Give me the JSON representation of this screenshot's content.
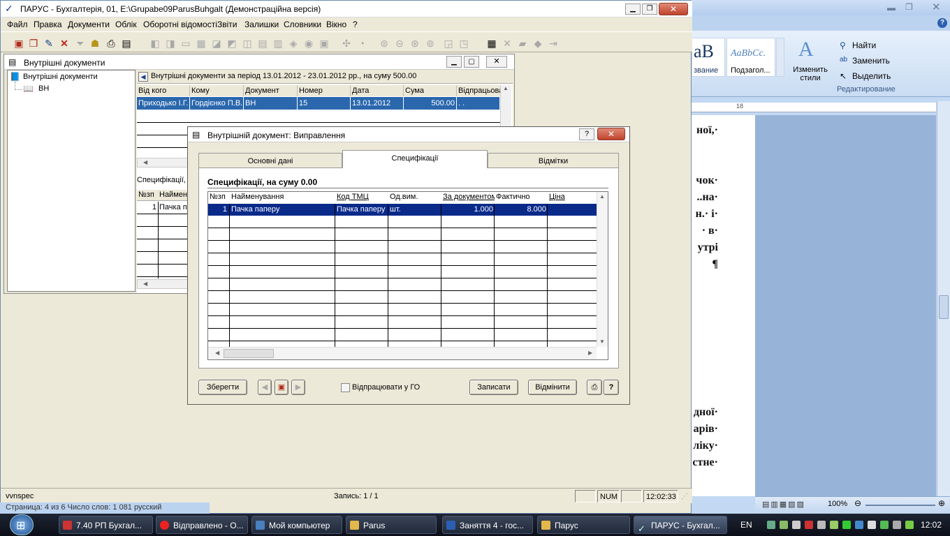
{
  "app": {
    "title": "ПАРУС - Бухгалтерія, 01, E:\\Grupabe09ParusBuhgalt (Демонстраційна версія)",
    "menu": [
      "Файл",
      "Правка",
      "Документи",
      "Облік",
      "Оборотні відомості",
      "Звіти",
      "Залишки",
      "Словники",
      "Вікно",
      "?"
    ]
  },
  "child": {
    "title": "Внутрішні документи",
    "tree": {
      "root": "Внутрішні документи",
      "child": "ВН"
    },
    "period_header": "Внутрішні документи за період 13.01.2012 - 23.01.2012 рр., на суму 500.00",
    "columns": [
      "Від кого",
      "Кому",
      "Документ",
      "Номер",
      "Дата",
      "Сума",
      "Відпрацьован"
    ],
    "rows": [
      {
        "from": "Приходько І.Г.",
        "to": "Гордієнко П.В.",
        "doc": "ВН",
        "num": "15",
        "date": "13.01.2012",
        "sum": "500.00",
        "processed": ". ."
      }
    ],
    "spec_label": "Специфікації, н",
    "spec_columns": [
      "№зп",
      "Найменув"
    ],
    "spec_rows": [
      {
        "num": "1",
        "name": "Пачка п"
      }
    ]
  },
  "dialog": {
    "title": "Внутрішній документ: Виправлення",
    "tabs": [
      "Основні дані",
      "Специфікації",
      "Відмітки"
    ],
    "spec_header": "Специфікації, на суму 0.00",
    "columns": [
      "№зп",
      "Найменування",
      "Код ТМЦ",
      "Од.вим.",
      "За документом",
      "Фактично",
      "Ціна"
    ],
    "rows": [
      {
        "num": "1",
        "name": "Пачка паперу",
        "code": "Пачка паперу",
        "unit": "шт.",
        "by_doc": "1.000",
        "actual": "8.000",
        "price": ""
      }
    ],
    "save_btn": "Зберегти",
    "checkbox_label": "Відпрацювати у ГО",
    "write_btn": "Записати",
    "cancel_btn": "Відмінити",
    "help_btn": "?"
  },
  "statusbar": {
    "left": "vvnspec",
    "record": "Запись: 1 / 1",
    "num": "NUM",
    "time": "12:02:33"
  },
  "word": {
    "styles_sample": "AaBbCc.",
    "styles_sample_big": "aB",
    "style1": "звание",
    "style2": "Подзагол...",
    "change_styles": "Изменить стили",
    "find": "Найти",
    "replace": "Заменить",
    "select": "Выделить",
    "editing_group": "Редактирование",
    "ruler_mark": "18",
    "text_lines_top": [
      "ної,·",
      "чок·",
      "..на·",
      "н.· і·",
      "·  в·",
      "утрі",
      "¶"
    ],
    "text_lines_bottom": [
      "дної·",
      "арів·",
      "ліку·",
      "стне·"
    ],
    "zoom": "100%",
    "status_left": "Страница: 4 из 6     Число слов: 1 081     русский"
  },
  "taskbar": {
    "items": [
      "7.40 РП Бухгал...",
      "Відправлено - О...",
      "Мой компьютер",
      "Parus",
      "Заняття 4 - гос...",
      "Парус",
      "ПАРУС - Бухгал..."
    ],
    "lang": "EN",
    "clock": "12:02"
  }
}
